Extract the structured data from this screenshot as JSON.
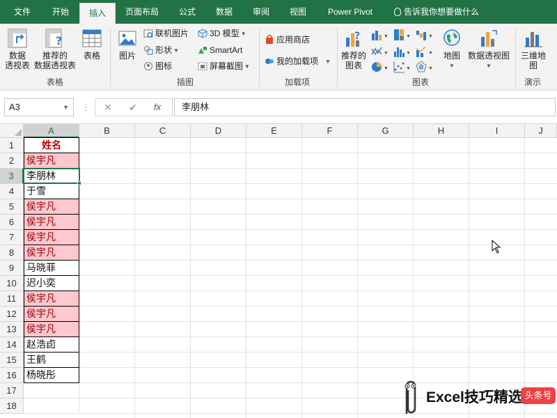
{
  "tabs": [
    {
      "label": "文件",
      "active": false
    },
    {
      "label": "开始",
      "active": false
    },
    {
      "label": "插入",
      "active": true
    },
    {
      "label": "页面布局",
      "active": false
    },
    {
      "label": "公式",
      "active": false
    },
    {
      "label": "数据",
      "active": false
    },
    {
      "label": "审阅",
      "active": false
    },
    {
      "label": "视图",
      "active": false
    },
    {
      "label": "Power Pivot",
      "active": false
    }
  ],
  "tell_me": "告诉我你想要做什么",
  "ribbon": {
    "groups": {
      "tables": "表格",
      "illustrations": "插图",
      "addins": "加载项",
      "charts": "图表",
      "tours": "演示"
    },
    "pivot_table": [
      "数据",
      "透视表"
    ],
    "recommended_pivot": [
      "推荐的",
      "数据透视表"
    ],
    "table": "表格",
    "pictures": "图片",
    "online_pictures": "联机图片",
    "shapes": "形状",
    "icons": "图标",
    "models_3d": "3D 模型",
    "smartart": "SmartArt",
    "screenshot": "屏幕截图",
    "store": "应用商店",
    "my_addins": "我的加载项",
    "recommended_charts": [
      "推荐的",
      "图表"
    ],
    "maps": "地图",
    "pivot_chart": "数据透视图",
    "map_3d": [
      "三维地",
      "图"
    ]
  },
  "formula_bar": {
    "name_box": "A3",
    "cancel": "✕",
    "enter": "✔",
    "fx": "fx",
    "value": "李朋林"
  },
  "columns": [
    "A",
    "B",
    "C",
    "D",
    "E",
    "F",
    "G",
    "H",
    "I",
    "J"
  ],
  "rows": [
    "1",
    "2",
    "3",
    "4",
    "5",
    "6",
    "7",
    "8",
    "9",
    "10",
    "11",
    "12",
    "13",
    "14",
    "15",
    "16",
    "17",
    "18"
  ],
  "cells_A": [
    {
      "text": "姓名",
      "style": "header"
    },
    {
      "text": "侯宇凡",
      "style": "dup"
    },
    {
      "text": "李朋林",
      "style": "normal"
    },
    {
      "text": "于雪",
      "style": "normal"
    },
    {
      "text": "侯宇凡",
      "style": "dup"
    },
    {
      "text": "侯宇凡",
      "style": "dup"
    },
    {
      "text": "侯宇凡",
      "style": "dup"
    },
    {
      "text": "侯宇凡",
      "style": "dup"
    },
    {
      "text": "马晓菲",
      "style": "normal"
    },
    {
      "text": "迟小奕",
      "style": "normal"
    },
    {
      "text": "侯宇凡",
      "style": "dup"
    },
    {
      "text": "侯宇凡",
      "style": "dup"
    },
    {
      "text": "侯宇凡",
      "style": "dup"
    },
    {
      "text": "赵浩卣",
      "style": "normal"
    },
    {
      "text": "王鹤",
      "style": "normal"
    },
    {
      "text": "杨晓彤",
      "style": "normal"
    },
    {
      "text": "",
      "style": "empty"
    },
    {
      "text": "",
      "style": "empty"
    }
  ],
  "colors": {
    "accent": "#217346",
    "dup_fill": "#ffc7ce",
    "dup_text": "#9c0006",
    "header_text": "#c00000"
  },
  "watermark": {
    "text": "Excel技巧精选",
    "badge": "头条号"
  }
}
